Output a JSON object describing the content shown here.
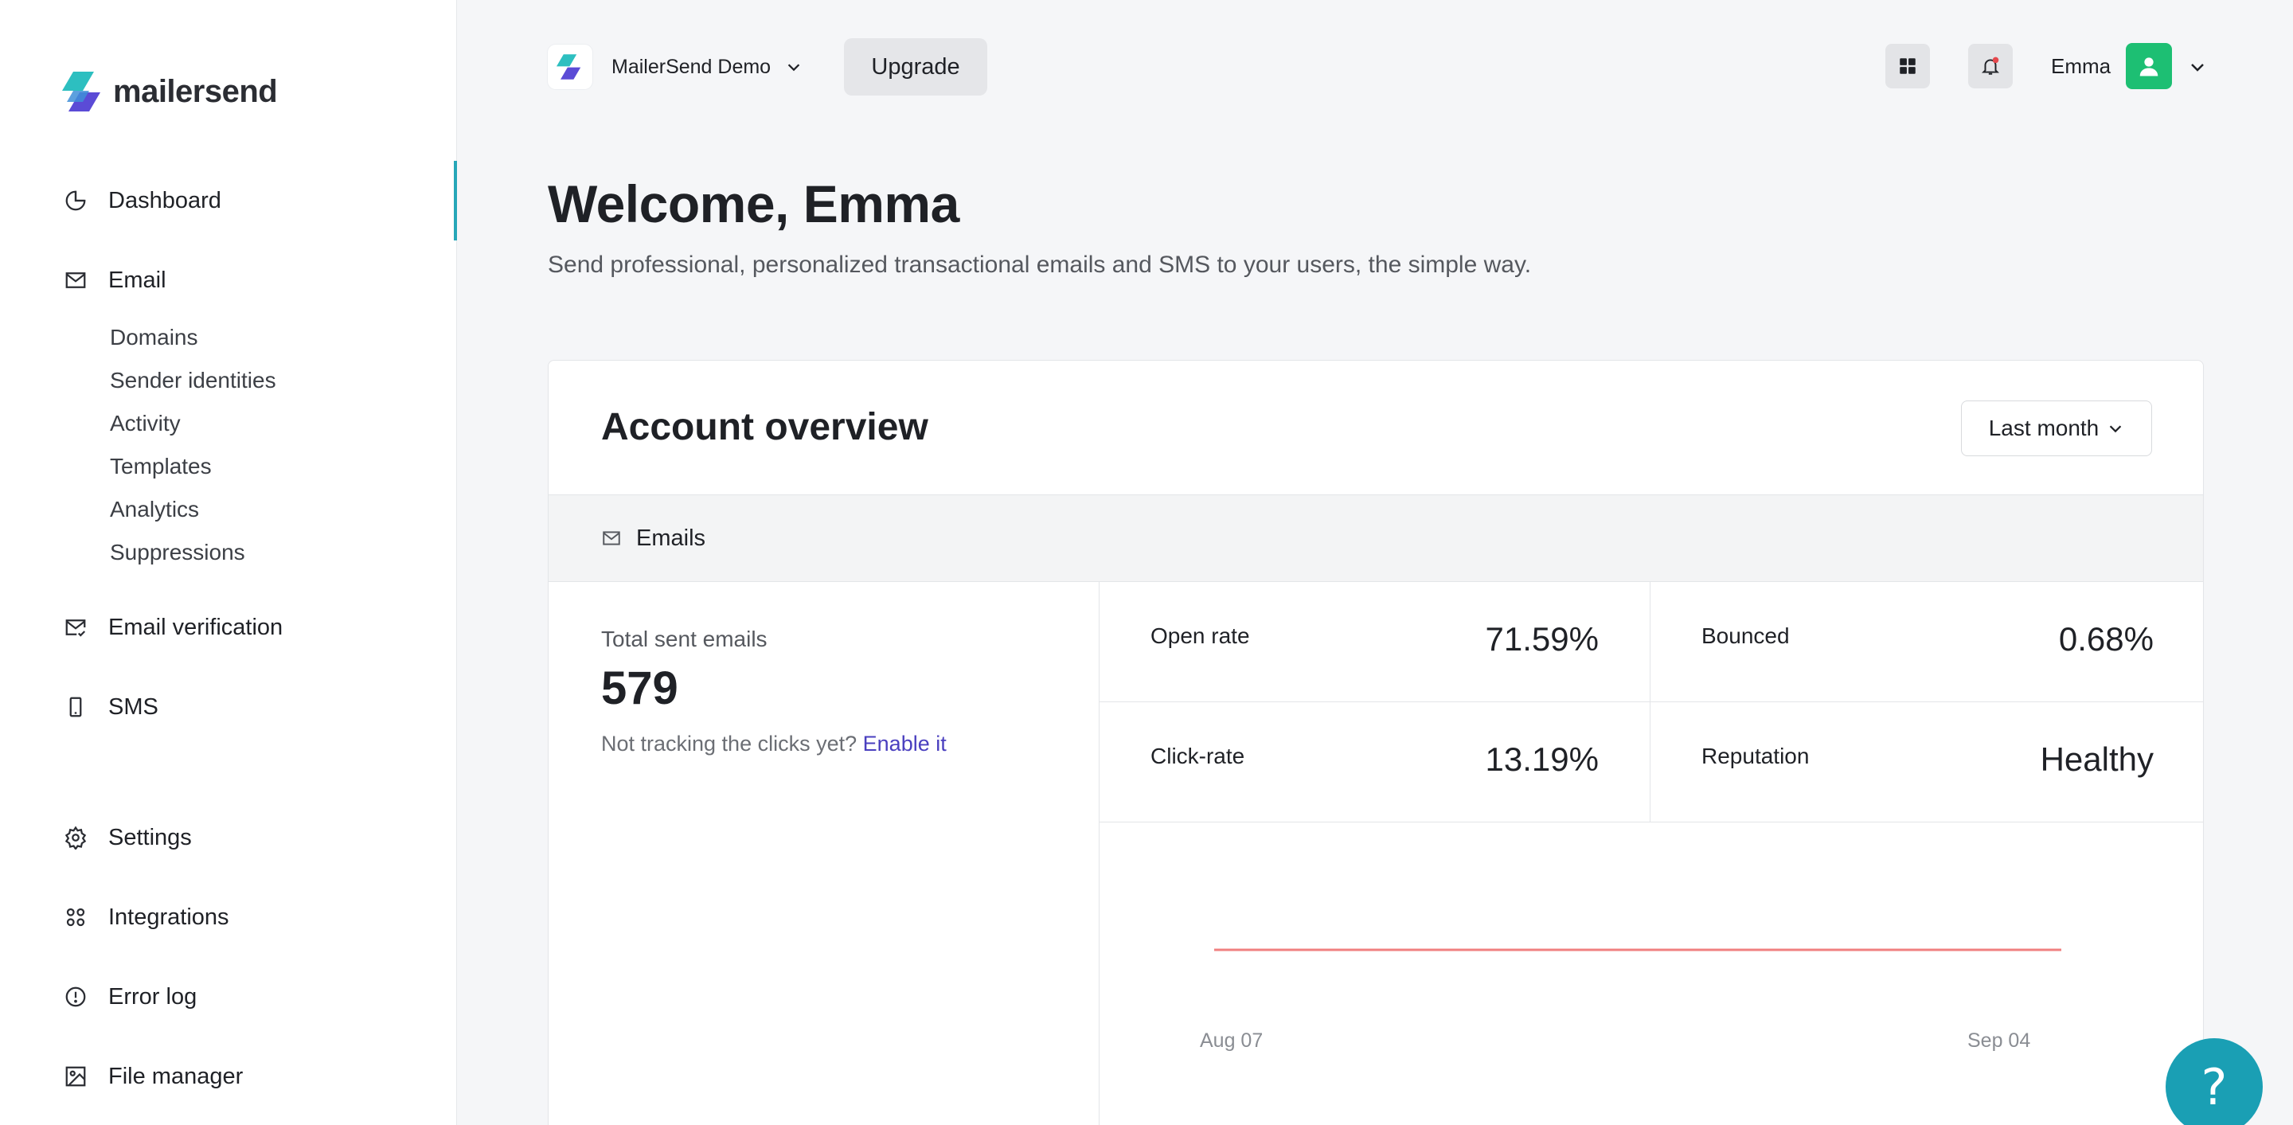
{
  "brand": {
    "name": "mailersend",
    "accent": "#27a7b8",
    "brand_purple": "#4a3fbf"
  },
  "sidebar": {
    "items": [
      {
        "label": "Dashboard",
        "icon": "pie-chart-icon",
        "active": true
      },
      {
        "label": "Email",
        "icon": "envelope-icon"
      },
      {
        "label": "Email verification",
        "icon": "mail-check-icon"
      },
      {
        "label": "SMS",
        "icon": "phone-icon"
      },
      {
        "label": "Settings",
        "icon": "gear-icon"
      },
      {
        "label": "Integrations",
        "icon": "integrations-icon"
      },
      {
        "label": "Error log",
        "icon": "alert-circle-icon"
      },
      {
        "label": "File manager",
        "icon": "image-icon"
      }
    ],
    "email_subitems": [
      "Domains",
      "Sender identities",
      "Activity",
      "Templates",
      "Analytics",
      "Suppressions"
    ]
  },
  "header": {
    "account_name": "MailerSend Demo",
    "upgrade_label": "Upgrade",
    "user_name": "Emma",
    "notification_dot_color": "#e5484d",
    "avatar_color": "#1dbf73"
  },
  "welcome": {
    "title": "Welcome, Emma",
    "subtitle": "Send professional, personalized transactional emails and SMS to your users, the simple way."
  },
  "overview": {
    "title": "Account overview",
    "period": "Last month",
    "section": "Emails",
    "total_label": "Total sent emails",
    "total_value": "579",
    "tracking_note": "Not tracking the clicks yet?",
    "tracking_link": "Enable it",
    "stats": [
      {
        "label": "Open rate",
        "value": "71.59%"
      },
      {
        "label": "Bounced",
        "value": "0.68%"
      },
      {
        "label": "Click-rate",
        "value": "13.19%"
      },
      {
        "label": "Reputation",
        "value": "Healthy"
      }
    ],
    "chart": {
      "x_labels": [
        "Aug 07",
        "Sep 04"
      ],
      "line_color": "#f08080"
    }
  },
  "help": {
    "label": "?"
  }
}
